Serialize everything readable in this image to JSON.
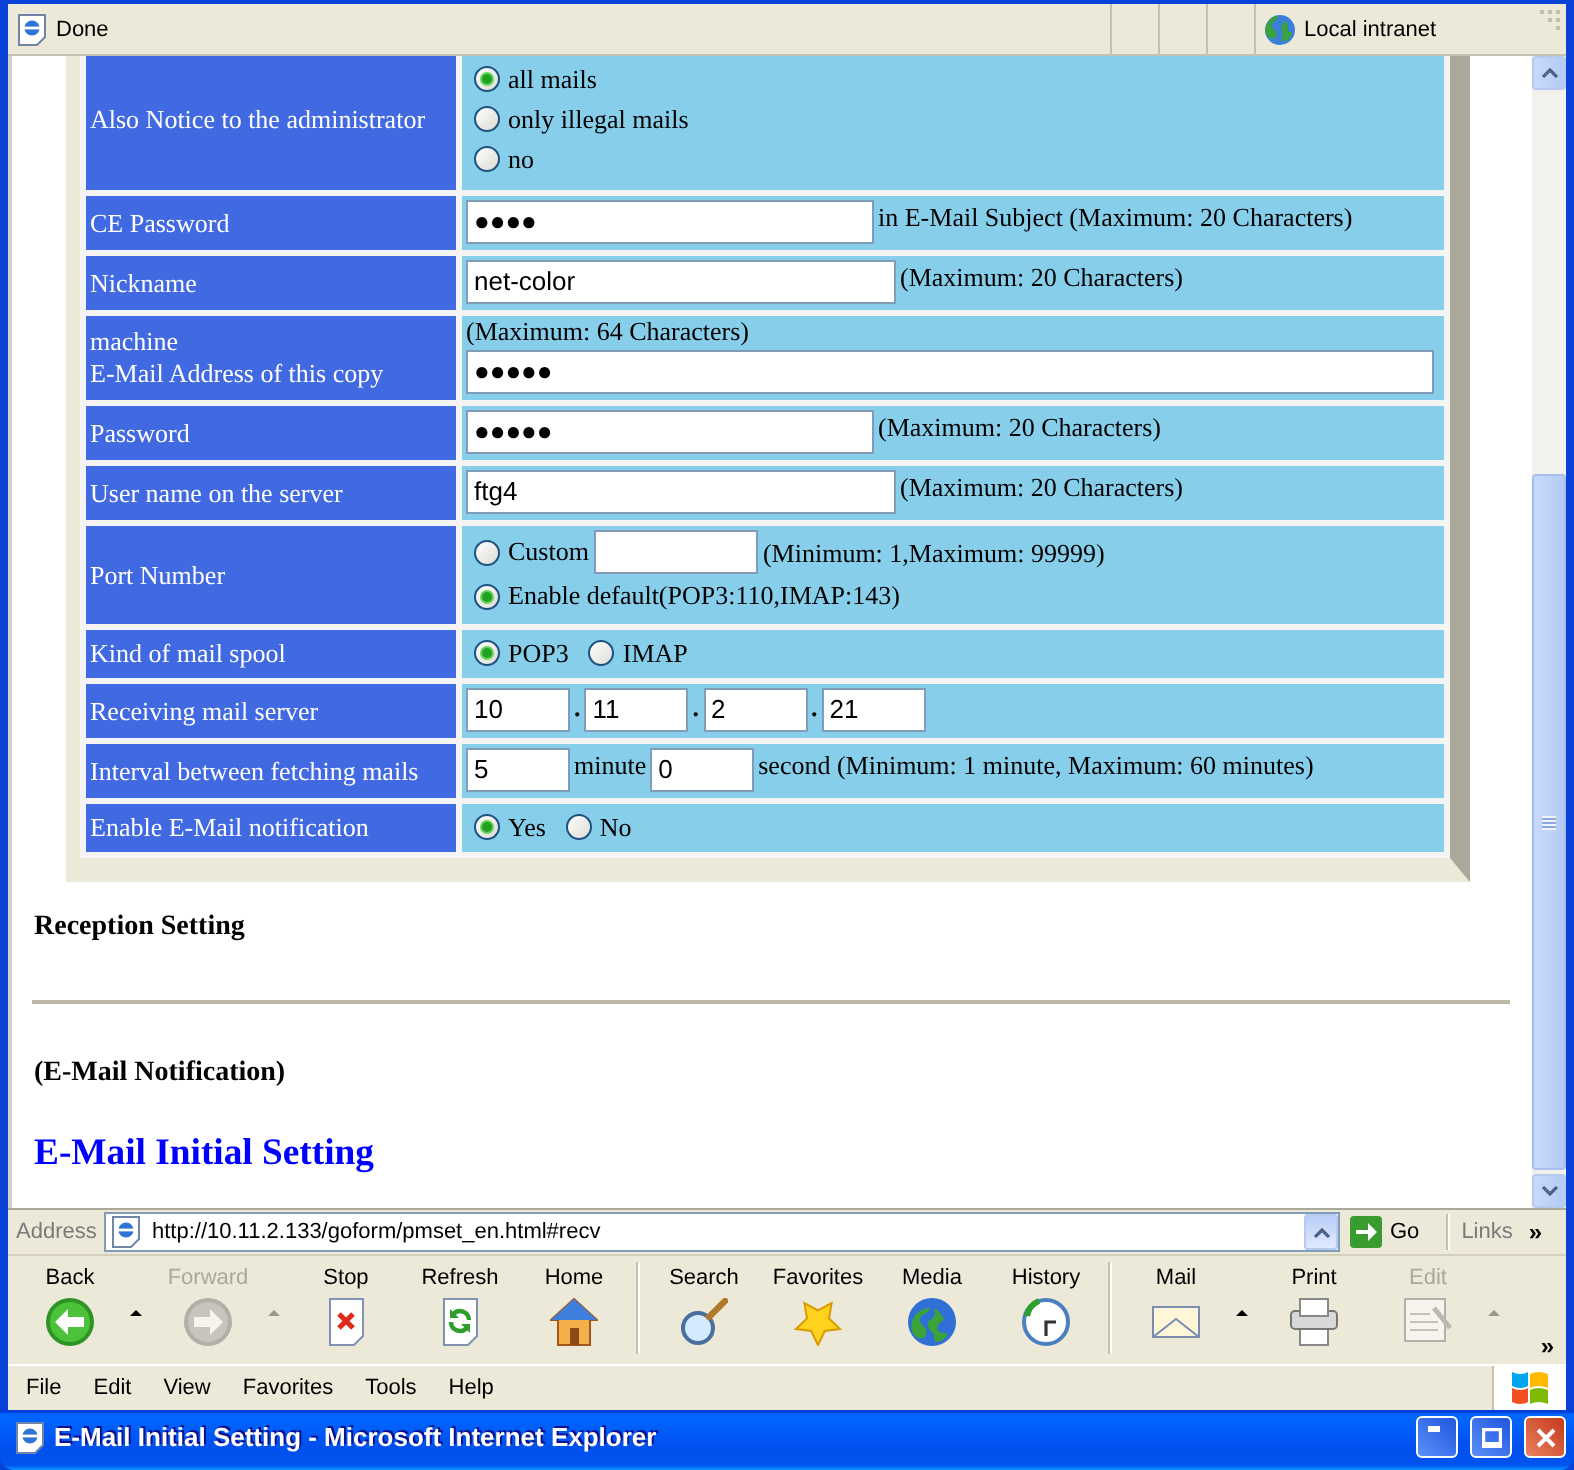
{
  "status_bar": {
    "text": "Done",
    "zone": "Local intranet"
  },
  "page": {
    "rows": [
      {
        "kind": "radio-list",
        "label": "Also Notice to the administrator",
        "options": [
          {
            "label": "all mails",
            "selected": true
          },
          {
            "label": "only illegal mails",
            "selected": false
          },
          {
            "label": "no",
            "selected": false
          }
        ]
      },
      {
        "kind": "password",
        "label": "CE Password",
        "value": "●●●●",
        "note": "in E-Mail Subject (Maximum: 20 Characters)"
      },
      {
        "kind": "text",
        "label": "Nickname",
        "value": "net-color",
        "note": "(Maximum: 20 Characters)"
      },
      {
        "kind": "email",
        "label_lines": [
          "machine",
          "E-Mail Address of this copy"
        ],
        "note": "(Maximum: 64 Characters)",
        "value": "●●●●●"
      },
      {
        "kind": "password",
        "label": "Password",
        "value": "●●●●●",
        "note": "(Maximum: 20 Characters)"
      },
      {
        "kind": "text",
        "label": "User name on the server",
        "value": "ftg4",
        "note": "(Maximum: 20 Characters)"
      },
      {
        "kind": "port",
        "label": "Port Number",
        "options": [
          {
            "kind": "custom",
            "label": "Custom",
            "selected": false,
            "note": "(Minimum: 1,Maximum: 99999)"
          },
          {
            "kind": "plain",
            "label": "Enable default(POP3:110,IMAP:143)",
            "selected": true
          }
        ]
      },
      {
        "kind": "radio-row",
        "label": "Kind of mail spool",
        "options": [
          {
            "label": "POP3",
            "selected": true
          },
          {
            "label": "IMAP",
            "selected": false
          }
        ]
      },
      {
        "kind": "ip",
        "label": "Receiving mail server",
        "octets": [
          {
            "value": "10",
            "separator": "."
          },
          {
            "value": "11",
            "separator": "."
          },
          {
            "value": "2",
            "separator": "."
          },
          {
            "value": "21"
          }
        ]
      },
      {
        "kind": "interval",
        "label": "Interval between fetching mails",
        "fields": [
          {
            "value": "5",
            "unit": "minute"
          },
          {
            "value": "0",
            "unit": "second (Minimum: 1 minute, Maximum: 60 minutes)"
          }
        ]
      },
      {
        "kind": "radio-row",
        "label": "Enable E-Mail notification",
        "options": [
          {
            "label": "Yes",
            "selected": true
          },
          {
            "label": "No",
            "selected": false
          }
        ]
      }
    ],
    "section": "Reception Setting",
    "subtitle": "(E-Mail Notification)",
    "title": "E-Mail Initial Setting"
  },
  "address_bar": {
    "label": "Address",
    "url": "http://10.11.2.133/goform/pmset_en.html#recv",
    "go": "Go",
    "links": "Links",
    "overflow": "»"
  },
  "toolbar": {
    "groups": [
      [
        {
          "label": "Back",
          "kind": "back",
          "disabled": false,
          "dropdown": true
        },
        {
          "label": "Forward",
          "kind": "forward",
          "disabled": true,
          "dropdown": true
        },
        {
          "label": "Stop",
          "kind": "stop",
          "disabled": false,
          "dropdown": false
        },
        {
          "label": "Refresh",
          "kind": "refresh",
          "disabled": false,
          "dropdown": false
        },
        {
          "label": "Home",
          "kind": "home",
          "disabled": false,
          "dropdown": false
        }
      ],
      [
        {
          "label": "Search",
          "kind": "search",
          "disabled": false,
          "dropdown": false
        },
        {
          "label": "Favorites",
          "kind": "favorites",
          "disabled": false,
          "dropdown": false
        },
        {
          "label": "Media",
          "kind": "media",
          "disabled": false,
          "dropdown": false
        },
        {
          "label": "History",
          "kind": "history",
          "disabled": false,
          "dropdown": false
        }
      ],
      [
        {
          "label": "Mail",
          "kind": "mail",
          "disabled": false,
          "dropdown": true
        },
        {
          "label": "Print",
          "kind": "print",
          "disabled": false,
          "dropdown": false
        },
        {
          "label": "Edit",
          "kind": "edit",
          "disabled": true,
          "dropdown": true
        }
      ]
    ],
    "overflow": "»"
  },
  "menu_bar": {
    "items": [
      "File",
      "Edit",
      "View",
      "Favorites",
      "Tools",
      "Help"
    ]
  },
  "window": {
    "title": "E-Mail Initial Setting - Microsoft Internet Explorer"
  }
}
